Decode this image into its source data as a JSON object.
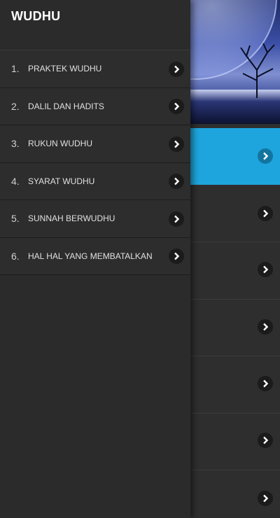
{
  "drawer": {
    "title": "WUDHU",
    "items": [
      {
        "number": "1.",
        "label": "PRAKTEK WUDHU",
        "icon": "chevron-right-icon"
      },
      {
        "number": "2.",
        "label": "DALIL DAN HADITS",
        "icon": "chevron-right-icon"
      },
      {
        "number": "3.",
        "label": "RUKUN WUDHU",
        "icon": "chevron-right-icon"
      },
      {
        "number": "4.",
        "label": "SYARAT WUDHU",
        "icon": "chevron-right-icon"
      },
      {
        "number": "5.",
        "label": "SUNNAH BERWUDHU",
        "icon": "chevron-right-icon"
      },
      {
        "number": "6.",
        "label": "HAL HAL YANG MEMBATALKAN",
        "icon": "chevron-right-icon"
      }
    ]
  },
  "colors": {
    "accent": "#1ea5dd",
    "drawer_bg": "#2b2b2b",
    "text": "#ffffff"
  }
}
